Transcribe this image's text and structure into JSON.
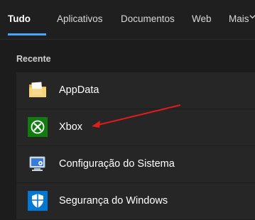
{
  "tabs": {
    "all": "Tudo",
    "apps": "Aplicativos",
    "documents": "Documentos",
    "web": "Web",
    "more": "Mais"
  },
  "section": {
    "label": "Recente"
  },
  "items": [
    {
      "label": "AppData",
      "icon": "folder-icon"
    },
    {
      "label": "Xbox",
      "icon": "xbox-icon"
    },
    {
      "label": "Configuração do Sistema",
      "icon": "system-config-icon"
    },
    {
      "label": "Segurança do Windows",
      "icon": "windows-security-icon"
    }
  ],
  "colors": {
    "accent": "#4aa3ff",
    "annotation_arrow": "#e21b1b"
  }
}
